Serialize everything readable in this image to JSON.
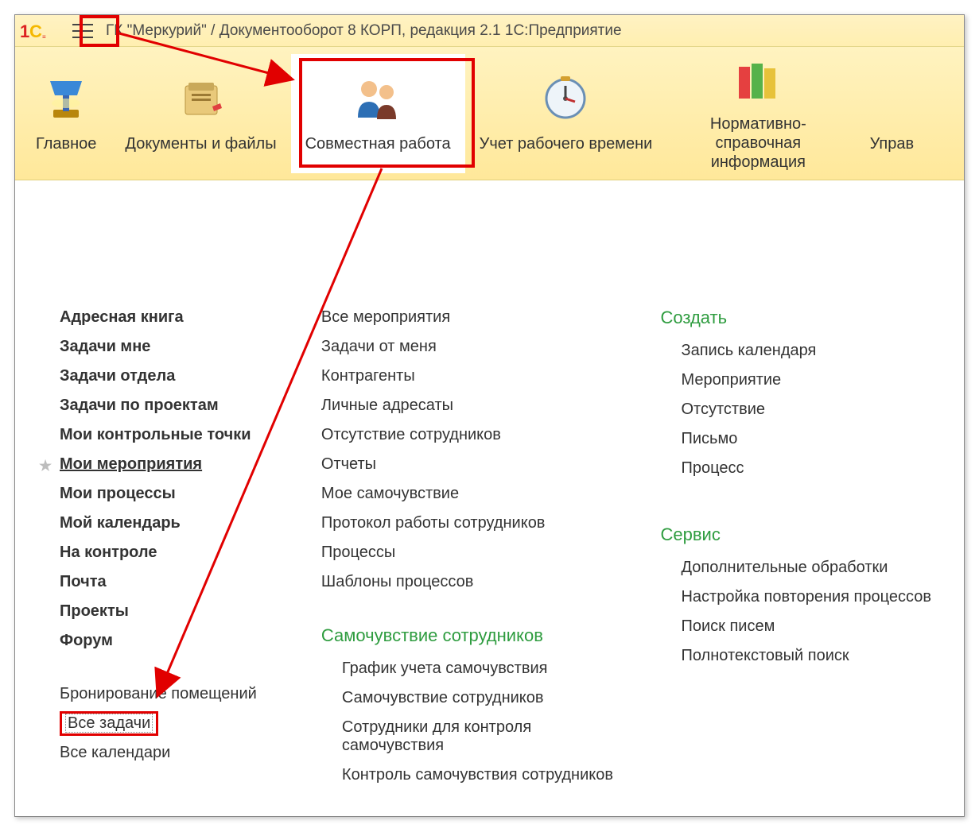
{
  "title": "ГК \"Меркурий\" / Документооборот 8 КОРП, редакция 2.1 1С:Предприятие",
  "nav": {
    "items": [
      {
        "label": "Главное",
        "icon": "lamp-icon"
      },
      {
        "label": "Документы и файлы",
        "icon": "docs-icon"
      },
      {
        "label": "Совместная работа",
        "icon": "people-icon"
      },
      {
        "label": "Учет рабочего времени",
        "icon": "clock-icon"
      },
      {
        "label": "Нормативно-справочная информация",
        "icon": "books-icon"
      },
      {
        "label": "Управ",
        "icon": "more-icon"
      }
    ]
  },
  "col1": {
    "items_bold": [
      "Адресная книга",
      "Задачи мне",
      "Задачи отдела",
      "Задачи по проектам",
      "Мои контрольные точки",
      "Мои мероприятия",
      "Мои процессы",
      "Мой календарь",
      "На контроле",
      "Почта",
      "Проекты",
      "Форум"
    ],
    "items_plain": [
      "Бронирование помещений",
      "Все задачи",
      "Все календари"
    ]
  },
  "col2": {
    "items1": [
      "Все мероприятия",
      "Задачи от меня",
      "Контрагенты",
      "Личные адресаты",
      "Отсутствие сотрудников",
      "Отчеты",
      "Мое самочувствие",
      "Протокол работы сотрудников",
      "Процессы",
      "Шаблоны процессов"
    ],
    "group2_head": "Самочувствие сотрудников",
    "items2": [
      "График учета самочувствия",
      "Самочувствие сотрудников",
      "Сотрудники для контроля самочувствия",
      "Контроль самочувствия сотрудников"
    ]
  },
  "col3": {
    "group1_head": "Создать",
    "items1": [
      "Запись календаря",
      "Мероприятие",
      "Отсутствие",
      "Письмо",
      "Процесс"
    ],
    "group2_head": "Сервис",
    "items2": [
      "Дополнительные обработки",
      "Настройка повторения процессов",
      "Поиск писем",
      "Полнотекстовый поиск"
    ]
  }
}
